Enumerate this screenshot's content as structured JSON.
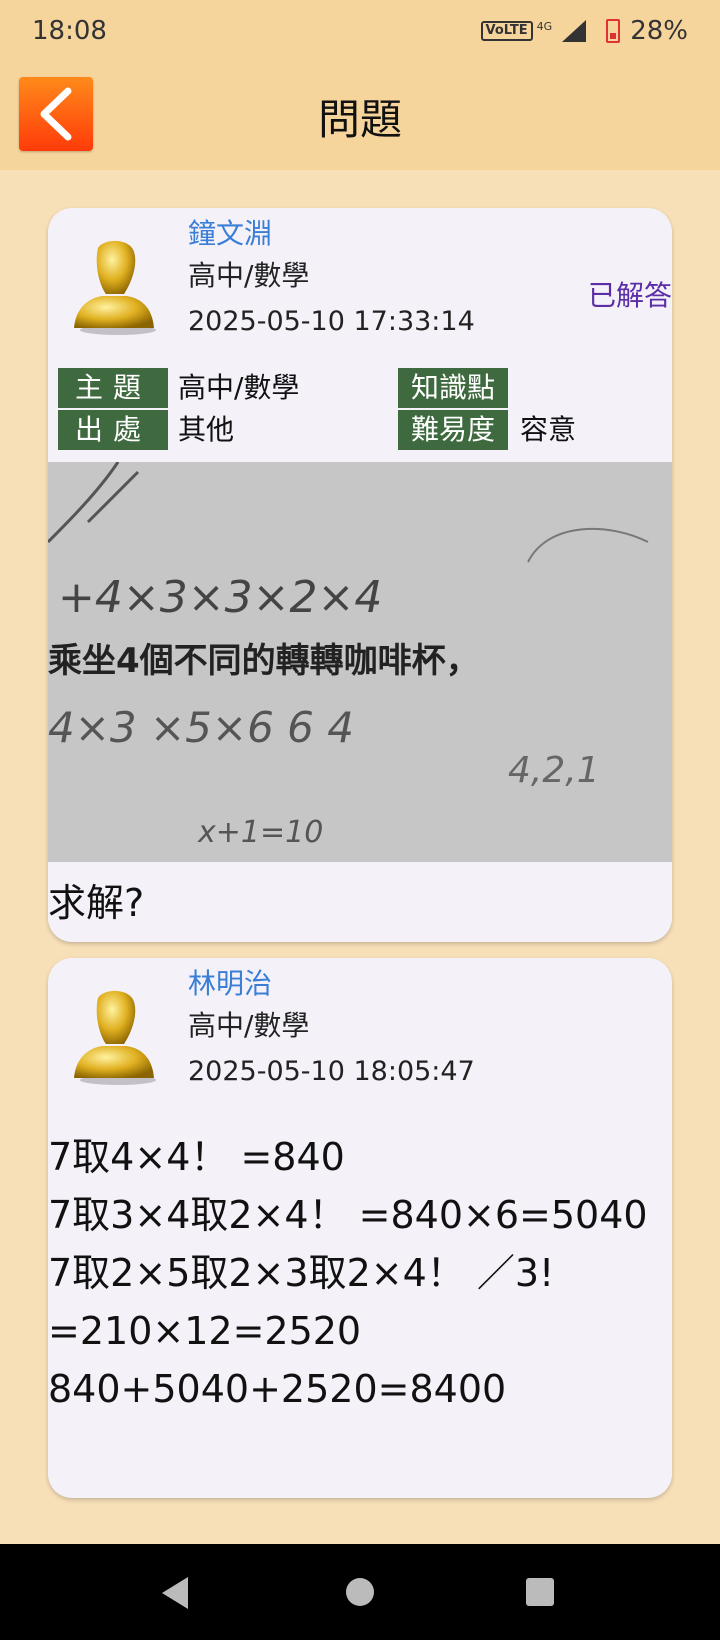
{
  "status_bar": {
    "time": "18:08",
    "volte": "VoLTE",
    "network": "4G",
    "battery": "28%"
  },
  "header": {
    "title": "問題",
    "back_icon": "chevron-left-icon"
  },
  "question_post": {
    "author": "鐘文淵",
    "subject": "高中/數學",
    "timestamp": "2025-05-10 17:33:14",
    "status": "已解答",
    "tags": {
      "topic_label": "主題",
      "topic_value": "高中/數學",
      "source_label": "出處",
      "source_value": "其他",
      "knowledge_label": "知識點",
      "knowledge_value": "",
      "difficulty_label": "難易度",
      "difficulty_value": "容意"
    },
    "photo_text": {
      "line1": "+4×3×3×2×4",
      "line2": "乘坐4個不同的轉轉咖啡杯，",
      "line3": "4×3 ×5×6 6 4",
      "line4": "4,2,1",
      "line5": "x+1=10"
    },
    "body": "求解?"
  },
  "answer_post": {
    "author": "林明治",
    "subject": "高中/數學",
    "timestamp": "2025-05-10 18:05:47",
    "lines": [
      "7取4×4！ =840",
      "7取3×4取2×4！ =840×6=5040",
      "7取2×5取2×3取2×4！ ／3!",
      "=210×12=2520",
      "840+5040+2520=8400"
    ]
  },
  "colors": {
    "background": "#f7e0b8",
    "app_bar": "#f6d59c",
    "card": "#f4f1f9",
    "author_blue": "#3a7ed6",
    "status_purple": "#5b2ea6",
    "tag_green": "#3f6a3f"
  }
}
